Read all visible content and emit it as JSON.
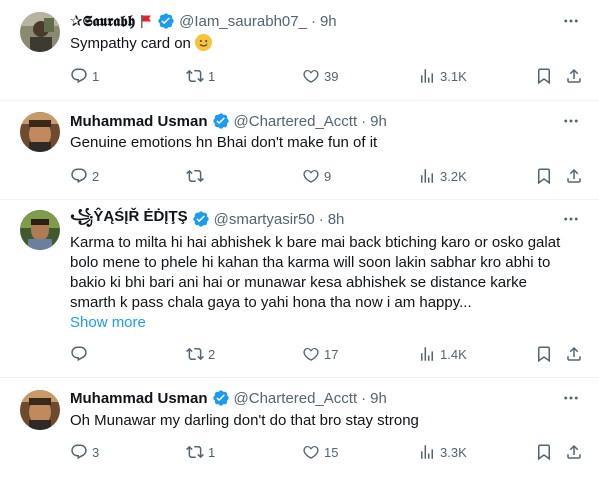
{
  "tweets": [
    {
      "name": "✰𝕾𝖆𝖚𝖗𝖆𝖇𝖍",
      "handle": "@Iam_saurabh07_",
      "dot": "·",
      "time": "9h",
      "text": "Sympathy card on",
      "replies": "1",
      "retweets": "1",
      "likes": "39",
      "views": "3.1K"
    },
    {
      "name": "Muhammad Usman",
      "handle": "@Chartered_Acctt",
      "dot": "·",
      "time": "9h",
      "text": "Genuine emotions hn Bhai don't make fun of it",
      "replies": "2",
      "retweets": "",
      "likes": "9",
      "views": "3.2K"
    },
    {
      "name": "꧁ŶĄŚĮŘ ĖḊĮŢŞ",
      "handle": "@smartyasir50",
      "dot": "·",
      "time": "8h",
      "text_lines": [
        "Karma to milta hi hai abhishek k bare mai back btiching karo or osko galat",
        "bolo mene to phele hi kahan tha karma will soon lakin sabhar kro abhi to",
        "bakio ki bhi bari ani hai or munawar kesa abhishek se distance karke",
        "smarth k pass chala gaya to yahi hona tha now i am happy..."
      ],
      "show_more": "Show more",
      "replies": "",
      "retweets": "2",
      "likes": "17",
      "views": "1.4K"
    },
    {
      "name": "Muhammad Usman",
      "handle": "@Chartered_Acctt",
      "dot": "·",
      "time": "9h",
      "text": "Oh Munawar my darling don't do that bro stay strong",
      "replies": "3",
      "retweets": "1",
      "likes": "15",
      "views": "3.3K"
    }
  ],
  "colors": {
    "accent": "#1d9bf0",
    "muted": "#536471",
    "text": "#0f1419",
    "divider": "#eff3f4"
  },
  "icons": {
    "verified": "verified-badge-icon",
    "reply": "reply-icon",
    "retweet": "retweet-icon",
    "like": "heart-icon",
    "views": "views-chart-icon",
    "bookmark": "bookmark-icon",
    "share": "share-icon",
    "more": "more-options-icon",
    "flag": "red-flag-icon",
    "emoji": "smiling-tear-emoji-icon"
  }
}
